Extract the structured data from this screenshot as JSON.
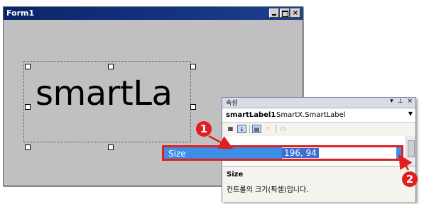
{
  "form": {
    "title": "Form1",
    "close_glyph": "×",
    "label_text": "smartLa"
  },
  "properties_panel": {
    "title": "속성",
    "title_icons": [
      "▾",
      "⊥",
      "×"
    ],
    "object_name": "smartLabel1",
    "object_type": "SmartX.SmartLabel",
    "toolbar": [
      "categorized-icon",
      "alphabetical-icon",
      "properties-icon",
      "events-icon",
      "property-pages-icon"
    ],
    "selected_property": {
      "name": "Size",
      "value": "196, 94"
    },
    "description": {
      "title": "Size",
      "text": "컨트롤의 크기(픽셀)입니다."
    }
  },
  "callouts": [
    "1",
    "2"
  ],
  "colors": {
    "highlight_border": "#e02020",
    "selected_row": "#3a8ee6",
    "titlebar": "#0a246a"
  }
}
